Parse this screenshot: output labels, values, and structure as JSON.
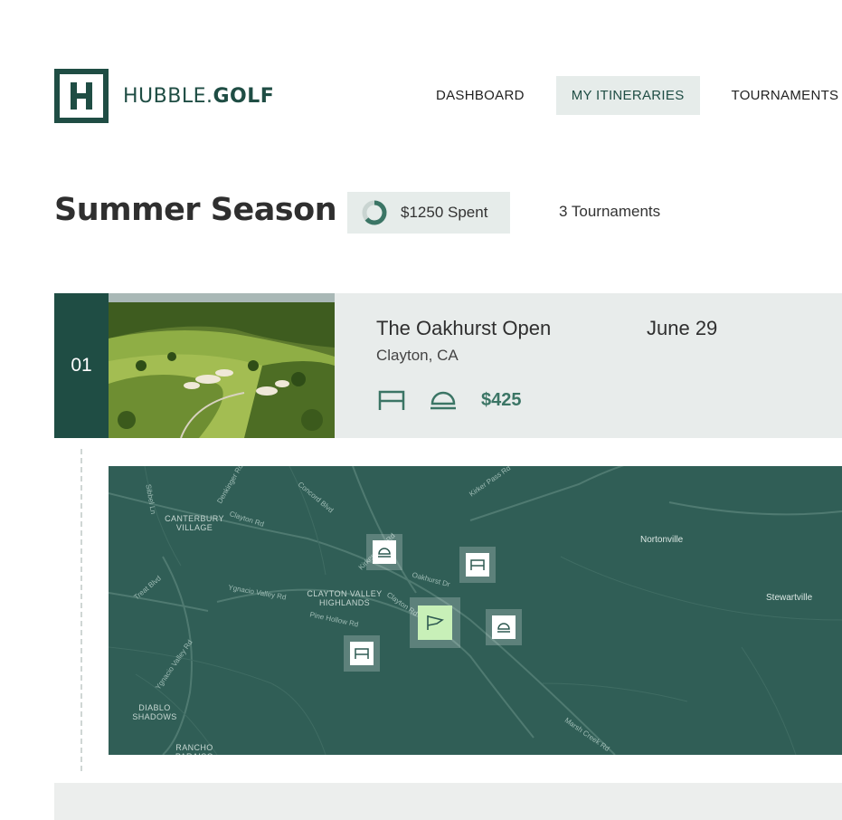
{
  "brand": {
    "name_light": "HUBBLE.",
    "name_bold": "GOLF",
    "logo_letter": "H",
    "color": "#1f4d44"
  },
  "nav": {
    "items": [
      {
        "label": "DASHBOARD",
        "active": false
      },
      {
        "label": "MY ITINERARIES",
        "active": true
      },
      {
        "label": "TOURNAMENTS",
        "active": false
      }
    ]
  },
  "season": {
    "title": "Summer Season",
    "spent": "$1250 Spent",
    "tournaments": "3 Tournaments"
  },
  "tournament": {
    "index": "01",
    "name": "The Oakhurst Open",
    "date": "June 29",
    "location": "Clayton, CA",
    "price": "$425",
    "icons": [
      "bed-icon",
      "food-service-icon"
    ]
  },
  "map": {
    "places": {
      "canterbury": "CANTERBURY\nVILLAGE",
      "clayton_valley": "CLAYTON VALLEY\nHIGHLANDS",
      "diablo": "DIABLO\nSHADOWS",
      "rancho": "RANCHO\nPARAISO",
      "nortonville": "Nortonville",
      "stewartville": "Stewartville"
    },
    "roads": {
      "sibbel": "Sibbel Ln",
      "denkinger": "Denkinger Rd",
      "concord": "Concord Blvd",
      "clayton": "Clayton Rd",
      "kirker": "Kirker Pass Rd",
      "kirker2": "Kirker Pass Rd",
      "oakhurst": "Oakhurst Dr",
      "clayton2": "Clayton Rd",
      "treat": "Treat Blvd",
      "ynacio": "Ygnacio Valley Rd",
      "pine": "Pine Hollow Rd",
      "ynacio2": "Ygnacio Valley Rd",
      "marsh": "Marsh Creek Rd"
    }
  },
  "colors": {
    "accent": "#1f4d44",
    "map": "#305e56",
    "card": "#e8eceb",
    "price": "#3b7565",
    "flag": "#c8f0b8"
  }
}
